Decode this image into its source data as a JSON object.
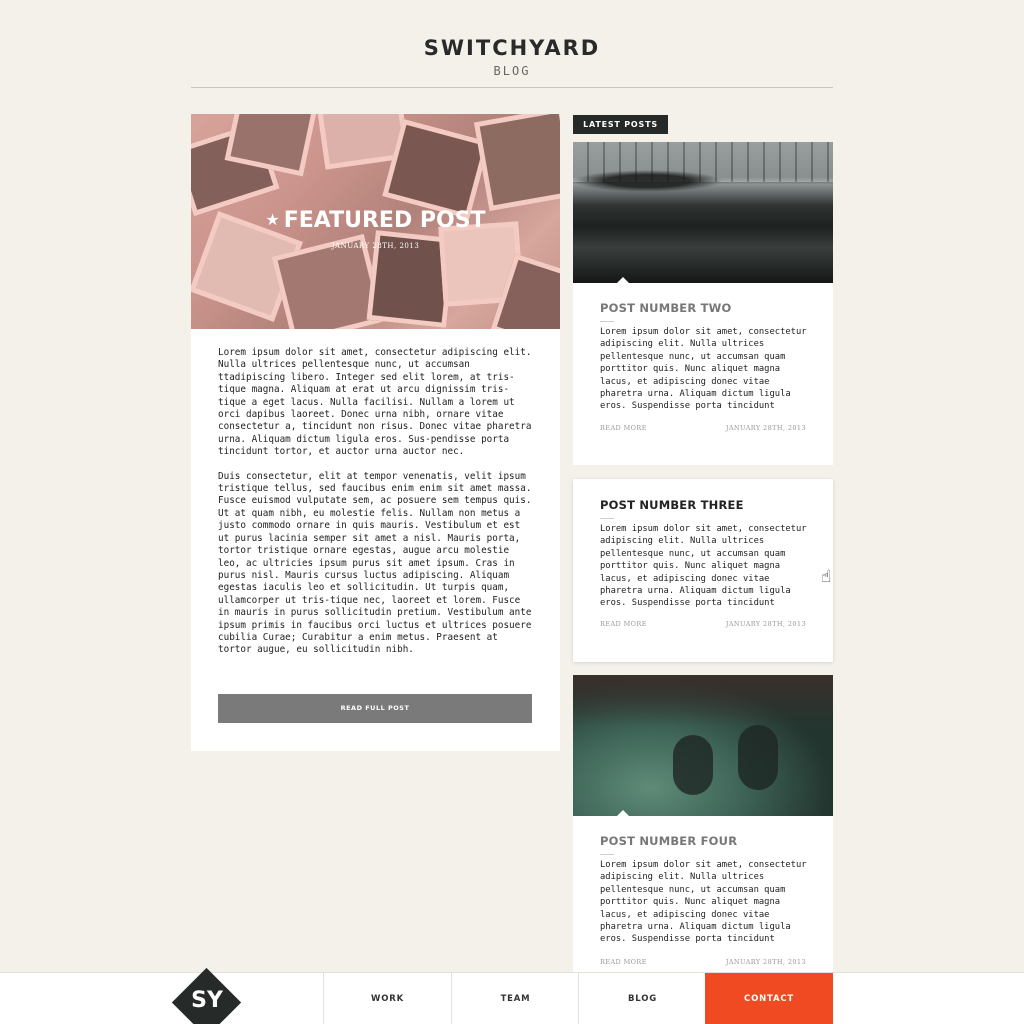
{
  "header": {
    "brand": "SWITCHYARD",
    "section": "BLOG"
  },
  "featured": {
    "title": "FEATURED POST",
    "date": "JANUARY 28TH, 2013",
    "paragraphs": [
      "Lorem ipsum dolor sit amet, consectetur adipiscing elit. Nulla ultrices pellentesque nunc, ut accumsan ttadipiscing libero. Integer sed elit lorem, at tris-tique magna. Aliquam at erat ut arcu dignissim tris-tique a eget lacus. Nulla facilisi. Nullam a lorem ut orci dapibus laoreet. Donec urna nibh, ornare vitae consectetur a, tincidunt non risus. Donec vitae pharetra urna. Aliquam dictum ligula eros. Sus-pendisse porta tincidunt tortor, et auctor urna auctor nec.",
      "Duis consectetur, elit at tempor venenatis, velit ipsum tristique tellus, sed faucibus enim enim sit amet massa. Fusce euismod vulputate sem, ac posuere sem tempus quis. Ut at quam nibh, eu molestie felis. Nullam non metus a justo commodo ornare in quis mauris. Vestibulum et est ut purus lacinia semper sit amet a nisl. Mauris porta, tortor tristique ornare egestas, augue arcu molestie leo, ac ultricies ipsum purus sit amet ipsum. Cras in purus nisl. Mauris cursus luctus adipiscing. Aliquam egestas iaculis leo et sollicitudin. Ut turpis quam, ullamcorper ut tris-tique nec, laoreet et lorem. Fusce in mauris in purus sollicitudin pretium. Vestibulum ante ipsum primis in faucibus orci luctus et ultrices posuere cubilia Curae; Curabitur a enim metus. Praesent at tortor augue, eu sollicitudin nibh."
    ],
    "button": "READ FULL POST"
  },
  "latest": {
    "tag": "LATEST POSTS",
    "posts": [
      {
        "title": "POST NUMBER TWO",
        "excerpt": "Lorem ipsum dolor sit amet, consectetur adipiscing elit. Nulla ultrices pellentesque nunc, ut accumsan quam porttitor quis. Nunc aliquet magna lacus, et adipiscing donec vitae pharetra urna. Aliquam dictum ligula eros. Suspendisse porta tincidunt",
        "read_more": "READ MORE",
        "date": "JANUARY 28TH, 2013"
      },
      {
        "title": "POST NUMBER THREE",
        "excerpt": "Lorem ipsum dolor sit amet, consectetur adipiscing elit. Nulla ultrices pellentesque nunc, ut accumsan quam porttitor quis. Nunc aliquet magna lacus, et adipiscing donec vitae pharetra urna. Aliquam dictum ligula eros. Suspendisse porta tincidunt",
        "read_more": "READ MORE",
        "date": "JANUARY 28TH, 2013"
      },
      {
        "title": "POST NUMBER FOUR",
        "excerpt": "Lorem ipsum dolor sit amet, consectetur adipiscing elit. Nulla ultrices pellentesque nunc, ut accumsan quam porttitor quis. Nunc aliquet magna lacus, et adipiscing donec vitae pharetra urna. Aliquam dictum ligula eros. Suspendisse porta tincidunt",
        "read_more": "READ MORE",
        "date": "JANUARY 28TH, 2013"
      }
    ]
  },
  "nav": {
    "logo": "SY",
    "items": [
      "WORK",
      "TEAM",
      "BLOG",
      "CONTACT"
    ]
  },
  "colors": {
    "background": "#f4f1ea",
    "accent": "#f04a23",
    "dark": "#252a28"
  }
}
